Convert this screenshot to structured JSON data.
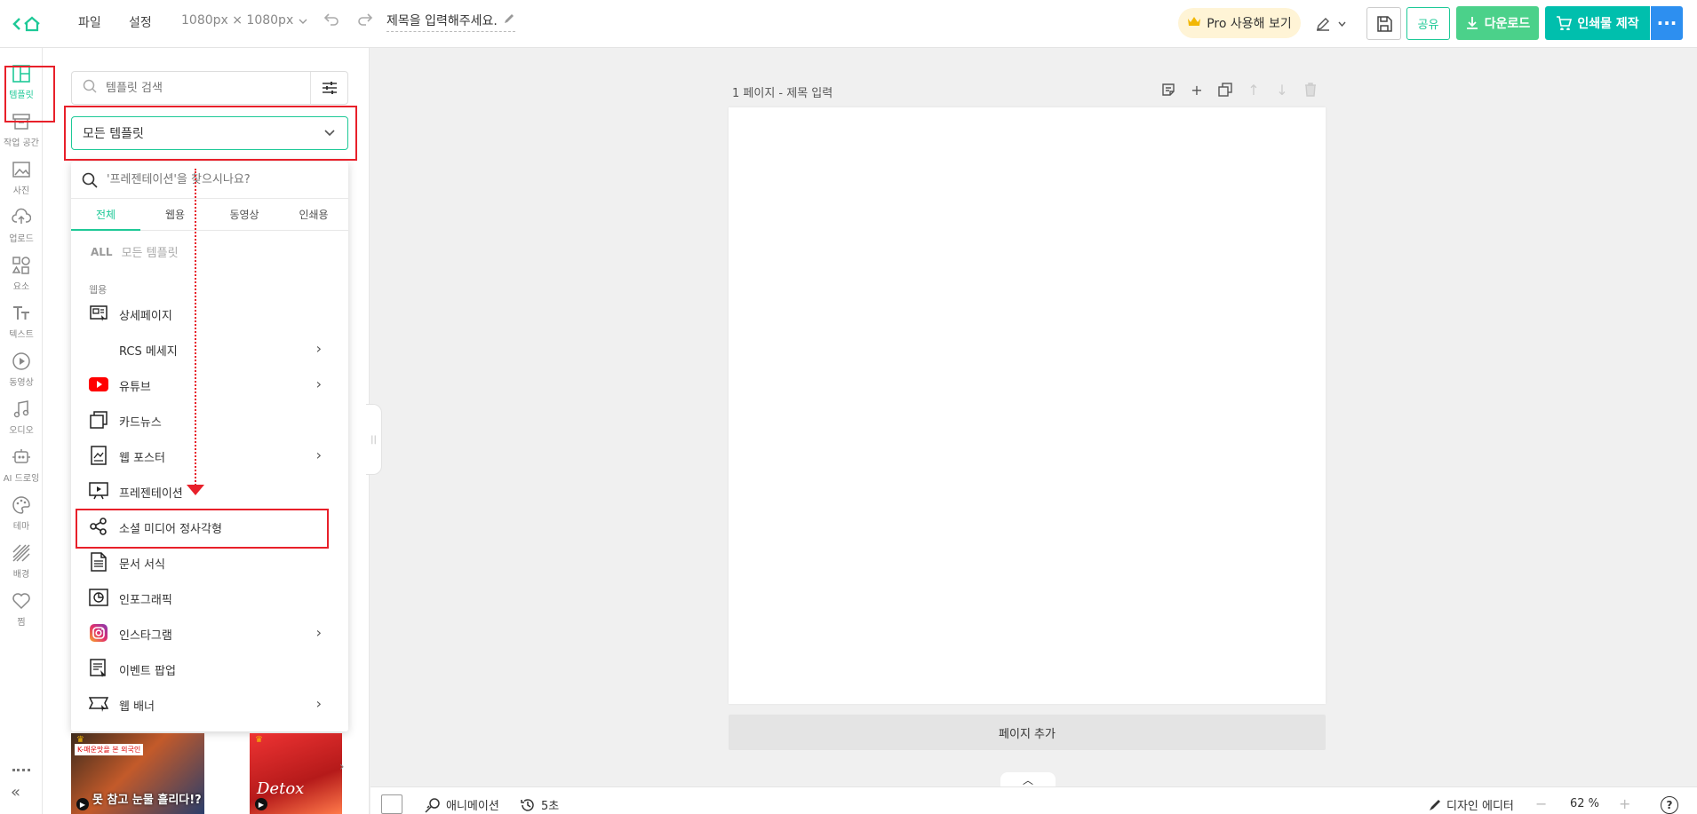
{
  "topbar": {
    "menu_file": "파일",
    "menu_settings": "설정",
    "canvas_size": "1080px × 1080px",
    "doc_title": "제목을 입력해주세요.",
    "pro_label": "Pro 사용해 보기",
    "share_label": "공유",
    "download_label": "다운로드",
    "print_label": "인쇄물 제작",
    "more_label": "···"
  },
  "sidebar": {
    "items": [
      {
        "label": "템플릿",
        "icon": "template-icon"
      },
      {
        "label": "작업 공간",
        "icon": "workspace-icon"
      },
      {
        "label": "사진",
        "icon": "photo-icon"
      },
      {
        "label": "업로드",
        "icon": "upload-icon"
      },
      {
        "label": "요소",
        "icon": "elements-icon"
      },
      {
        "label": "텍스트",
        "icon": "text-icon"
      },
      {
        "label": "동영상",
        "icon": "video-icon"
      },
      {
        "label": "오디오",
        "icon": "audio-icon"
      },
      {
        "label": "AI 드로잉",
        "icon": "ai-drawing-icon"
      },
      {
        "label": "테마",
        "icon": "theme-icon"
      },
      {
        "label": "배경",
        "icon": "background-icon"
      },
      {
        "label": "찜",
        "icon": "heart-icon"
      }
    ],
    "collapse": "«"
  },
  "panel": {
    "search_placeholder": "템플릿 검색",
    "selected_template": "모든 템플릿",
    "dropdown": {
      "search_placeholder": "'프레젠테이션'을 찾으시나요?",
      "tabs": [
        "전체",
        "웹용",
        "동영상",
        "인쇄용"
      ],
      "all_tag": "ALL",
      "all_label": "모든 템플릿",
      "section_web": "웹용",
      "items": [
        {
          "label": "상세페이지",
          "icon": "detail-page-icon",
          "has_submenu": false
        },
        {
          "label": "RCS 메세지",
          "icon": "",
          "has_submenu": true
        },
        {
          "label": "유튜브",
          "icon": "youtube-icon",
          "has_submenu": true
        },
        {
          "label": "카드뉴스",
          "icon": "card-news-icon",
          "has_submenu": false
        },
        {
          "label": "웹 포스터",
          "icon": "web-poster-icon",
          "has_submenu": true
        },
        {
          "label": "프레젠테이션",
          "icon": "presentation-icon",
          "has_submenu": false
        },
        {
          "label": "소셜 미디어 정사각형",
          "icon": "share-icon",
          "has_submenu": false
        },
        {
          "label": "문서 서식",
          "icon": "document-icon",
          "has_submenu": false
        },
        {
          "label": "인포그래픽",
          "icon": "infographic-icon",
          "has_submenu": false
        },
        {
          "label": "인스타그램",
          "icon": "instagram-icon",
          "has_submenu": true
        },
        {
          "label": "이벤트 팝업",
          "icon": "event-popup-icon",
          "has_submenu": false
        },
        {
          "label": "웹 배너",
          "icon": "web-banner-icon",
          "has_submenu": true
        }
      ]
    },
    "thumb1_tag": "K-매운맛을 본 외국인",
    "thumb1_caption": "못 참고 눈물 흘리다!?",
    "thumb2_caption": "Detox"
  },
  "canvas": {
    "page_label": "1 페이지 - 제목 입력",
    "add_page": "페이지 추가"
  },
  "bottombar": {
    "animation_label": "애니메이션",
    "duration_label": "5초",
    "editor_label": "디자인 에디터",
    "zoom_minus": "−",
    "zoom_value": "62 %",
    "zoom_plus": "+",
    "help": "?"
  },
  "colors": {
    "accent": "#1ec997",
    "annotation_red": "#e8202a",
    "download_green": "#4bd18a",
    "print_teal": "#00bfad",
    "more_blue": "#2d8ff0"
  }
}
